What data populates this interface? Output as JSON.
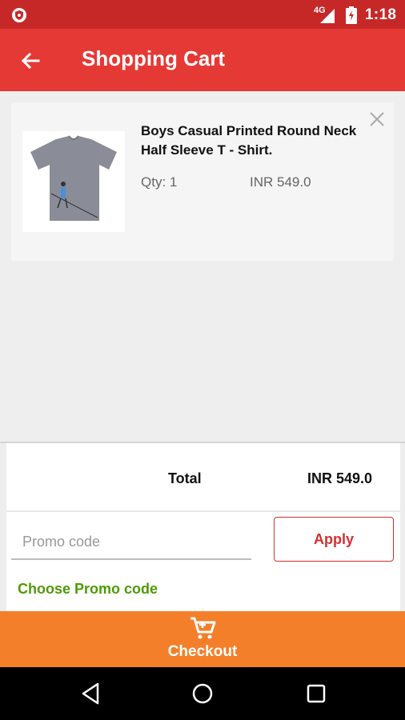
{
  "status_bar": {
    "network": "4G",
    "time": "1:18"
  },
  "app_bar": {
    "title": "Shopping Cart"
  },
  "cart": {
    "items": [
      {
        "name": "Boys Casual Printed Round Neck Half Sleeve T - Shirt.",
        "qty_label": "Qty: 1",
        "price": "INR 549.0"
      }
    ]
  },
  "summary": {
    "total_label": "Total",
    "total_value": "INR 549.0",
    "promo_placeholder": "Promo code",
    "apply_label": "Apply",
    "choose_promo": "Choose Promo code"
  },
  "checkout": {
    "label": "Checkout"
  },
  "colors": {
    "status": "#c62828",
    "appbar": "#e53935",
    "checkout": "#f47f2a",
    "promo_link": "#4e9a06"
  },
  "icons": [
    "app-badge-icon",
    "signal-icon",
    "battery-charging-icon",
    "back-arrow-icon",
    "close-icon",
    "cart-icon",
    "nav-back-icon",
    "nav-home-icon",
    "nav-recents-icon"
  ]
}
